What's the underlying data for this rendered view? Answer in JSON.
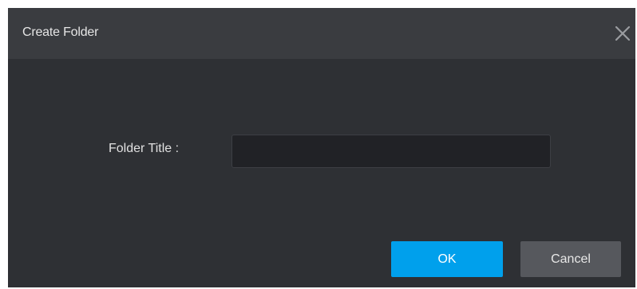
{
  "dialog": {
    "title": "Create Folder",
    "close_icon": "close-icon"
  },
  "form": {
    "folder_title_label": "Folder Title :",
    "folder_title_value": "",
    "folder_title_placeholder": ""
  },
  "buttons": {
    "ok_label": "OK",
    "cancel_label": "Cancel"
  },
  "colors": {
    "dialog_bg": "#2e3034",
    "titlebar_bg": "#3a3c40",
    "input_bg": "#212226",
    "ok_button": "#00a0ec",
    "cancel_button": "#56585d"
  }
}
